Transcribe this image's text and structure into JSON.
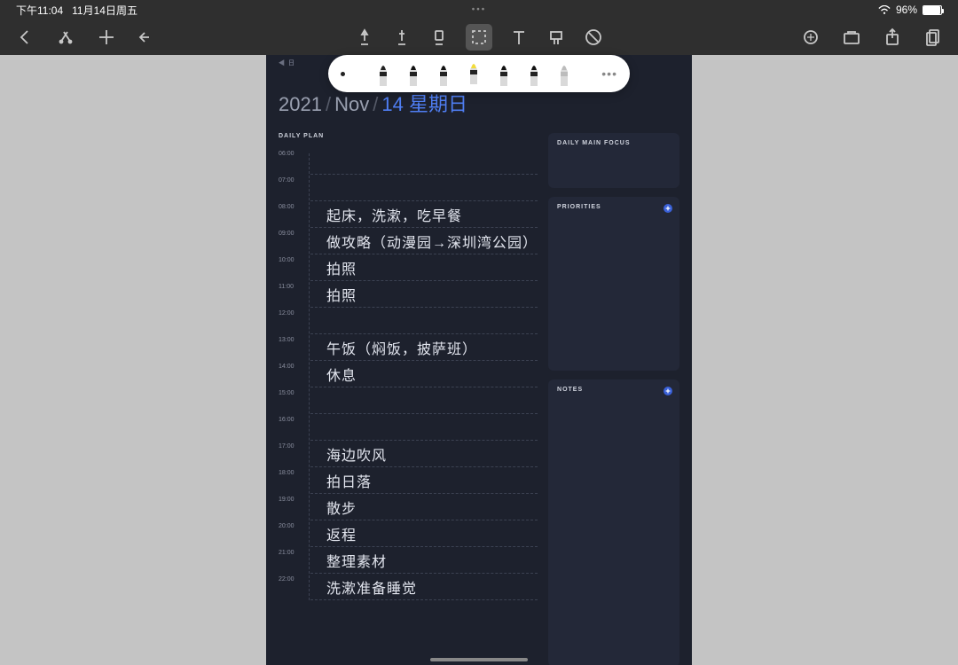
{
  "status": {
    "time": "下午11:04",
    "date": "11月14日周五",
    "battery_pct": "96%"
  },
  "date_header": {
    "year": "2021",
    "month": "Nov",
    "day": "14",
    "weekday": "星期日"
  },
  "panels": {
    "daily_plan": "DAILY PLAN",
    "focus": "DAILY MAIN FOCUS",
    "priorities": "PRIORITIES",
    "notes": "NOTES"
  },
  "timeline": [
    {
      "hour": "06:00",
      "text": ""
    },
    {
      "hour": "07:00",
      "text": ""
    },
    {
      "hour": "08:00",
      "text": "起床，洗漱，吃早餐"
    },
    {
      "hour": "09:00",
      "text": "做攻略（动漫园→深圳湾公园）"
    },
    {
      "hour": "10:00",
      "text": "拍照"
    },
    {
      "hour": "11:00",
      "text": "拍照"
    },
    {
      "hour": "12:00",
      "text": ""
    },
    {
      "hour": "13:00",
      "text": "午饭（焖饭，披萨班）"
    },
    {
      "hour": "14:00",
      "text": "休息"
    },
    {
      "hour": "15:00",
      "text": ""
    },
    {
      "hour": "16:00",
      "text": ""
    },
    {
      "hour": "17:00",
      "text": "海边吹风"
    },
    {
      "hour": "18:00",
      "text": "拍日落"
    },
    {
      "hour": "19:00",
      "text": "散步"
    },
    {
      "hour": "20:00",
      "text": "返程"
    },
    {
      "hour": "21:00",
      "text": "整理素材"
    },
    {
      "hour": "22:00",
      "text": "洗漱准备睡觉"
    }
  ],
  "pens": [
    {
      "name": "fineliner",
      "color": "#222",
      "accentTop": "#222"
    },
    {
      "name": "pen-black-1",
      "color": "#222",
      "accentTop": "#111"
    },
    {
      "name": "pen-black-2",
      "color": "#222",
      "accentTop": "#111"
    },
    {
      "name": "highlighter-yellow",
      "color": "#222",
      "accentTop": "#f2dc3c",
      "selected": true
    },
    {
      "name": "pen-grey",
      "color": "#222",
      "accentTop": "#111"
    },
    {
      "name": "marker",
      "color": "#222",
      "accentTop": "#111"
    },
    {
      "name": "eraser",
      "color": "#bcbcbc",
      "accentTop": "#bcbcbc"
    }
  ]
}
